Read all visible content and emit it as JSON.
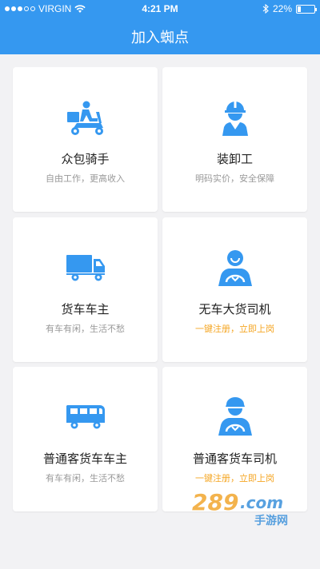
{
  "status_bar": {
    "carrier": "VIRGIN",
    "time": "4:21 PM",
    "battery": "22%",
    "battery_level": 0.22
  },
  "header": {
    "title": "加入蜘点"
  },
  "cards": [
    {
      "name": "众包骑手",
      "sub": "自由工作，更高收入",
      "icon": "scooter-rider-icon",
      "sub_color": "gray"
    },
    {
      "name": "装卸工",
      "sub": "明码实价，安全保障",
      "icon": "worker-helmet-icon",
      "sub_color": "gray"
    },
    {
      "name": "货车车主",
      "sub": "有车有闲，生活不愁",
      "icon": "truck-icon",
      "sub_color": "gray"
    },
    {
      "name": "无车大货司机",
      "sub": "一键注册，立即上岗",
      "icon": "driver-icon",
      "sub_color": "orange"
    },
    {
      "name": "普通客货车车主",
      "sub": "有车有闲，生活不愁",
      "icon": "van-icon",
      "sub_color": "gray"
    },
    {
      "name": "普通客货车司机",
      "sub": "一键注册，立即上岗",
      "icon": "driver-capped-icon",
      "sub_color": "orange"
    }
  ],
  "watermark": {
    "text": "289.com",
    "sub": "手游网"
  },
  "colors": {
    "accent": "#3598f0",
    "orange": "#f5a623"
  }
}
